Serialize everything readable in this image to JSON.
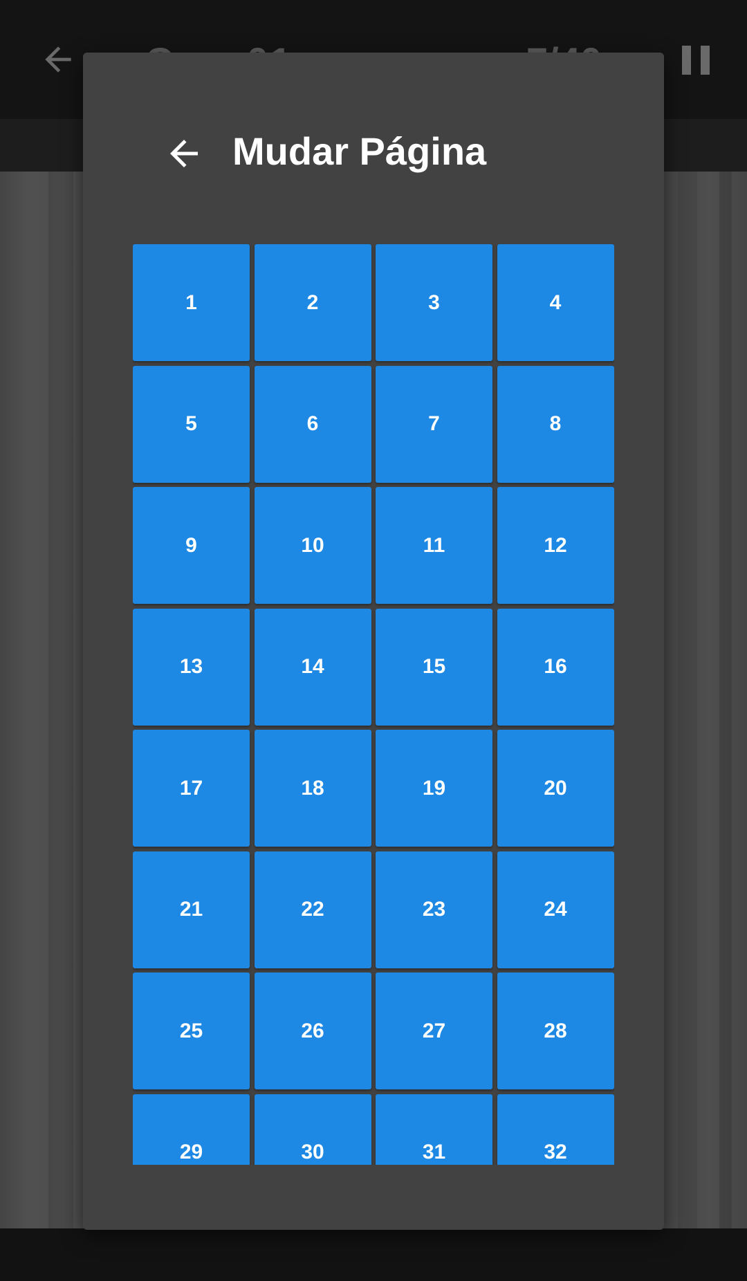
{
  "toolbar": {
    "title": "Cap. 01",
    "counter": "7/40"
  },
  "dialog": {
    "title": "Mudar Página",
    "pages": [
      "1",
      "2",
      "3",
      "4",
      "5",
      "6",
      "7",
      "8",
      "9",
      "10",
      "11",
      "12",
      "13",
      "14",
      "15",
      "16",
      "17",
      "18",
      "19",
      "20",
      "21",
      "22",
      "23",
      "24",
      "25",
      "26",
      "27",
      "28",
      "29",
      "30",
      "31",
      "32"
    ]
  },
  "colors": {
    "accent": "#1e88e5",
    "dialog_bg": "#424242",
    "scrim": "#121212"
  },
  "icons": {
    "toolbar_back": "arrow-back-icon",
    "toolbar_pause": "pause-icon",
    "dialog_back": "arrow-back-icon"
  }
}
